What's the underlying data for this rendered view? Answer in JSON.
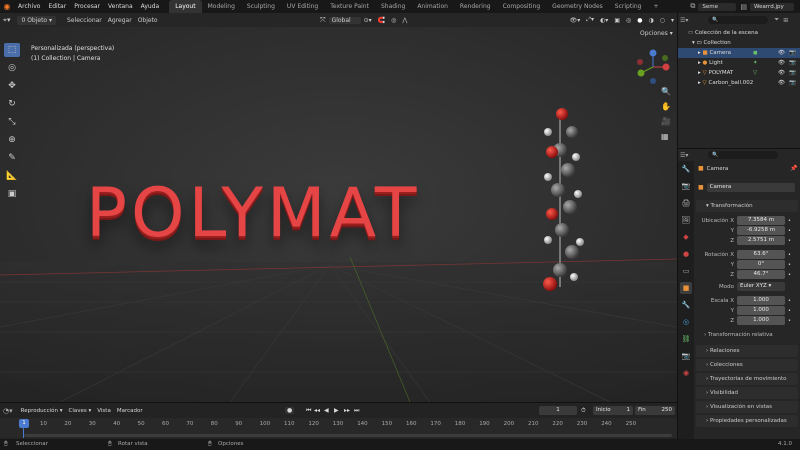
{
  "topbar": {
    "menus": [
      "Archivo",
      "Editar",
      "Procesar",
      "Ventana",
      "Ayuda"
    ],
    "workspaces": [
      "Layout",
      "Modeling",
      "Sculpting",
      "UV Editing",
      "Texture Paint",
      "Shading",
      "Animation",
      "Rendering",
      "Compositing",
      "Geometry Nodes",
      "Scripting"
    ],
    "active_workspace": "Layout",
    "scene": "Seme",
    "view_layer": "Wearrd.jpy"
  },
  "viewport_header": {
    "object_mode": "0 Objeto",
    "menus": [
      "Seleccionar",
      "Agregar",
      "Objeto"
    ],
    "transform_orientation": "Global",
    "options": "Opciones"
  },
  "viewport": {
    "view_name": "Personalizada (perspectiva)",
    "collection_info": "(1) Collection | Camera",
    "scene_text": "POLYMAT",
    "gizmo_axes": {
      "x": "X",
      "y": "Y",
      "z": "Z"
    }
  },
  "outliner": {
    "root": "Colección de la escena",
    "items": [
      {
        "name": "Collection",
        "color": "#cccccc"
      },
      {
        "name": "Camera",
        "color": "#ffffff"
      },
      {
        "name": "Light",
        "color": "#dddddd"
      },
      {
        "name": "POLYMAT",
        "color": "#dddddd"
      },
      {
        "name": "Carbon_ball.002",
        "color": "#dddddd"
      }
    ]
  },
  "properties": {
    "object_name": "Camera",
    "object_field": "Camera",
    "transform_title": "Transformación",
    "location_label": "Ubicación X",
    "location": [
      "7.3584 m",
      "-6.9258 m",
      "2.5751 m"
    ],
    "rotation_label": "Rotación X",
    "rotation": [
      "63.6°",
      "0°",
      "46.7°"
    ],
    "mode_label": "Modo",
    "mode_value": "Euler XYZ",
    "scale_label": "Escala X",
    "scale": [
      "1.000",
      "1.000",
      "1.000"
    ],
    "axis_y": "Y",
    "axis_z": "Z",
    "delta_title": "Transformación relativa",
    "panels": [
      "Relaciones",
      "Colecciones",
      "Trayectorias de movimiento",
      "Visibilidad",
      "Visualización en vistas",
      "Propiedades personalizadas"
    ]
  },
  "timeline": {
    "menus": [
      "Reproducción",
      "Claves",
      "Vista",
      "Marcador"
    ],
    "current_frame": "1",
    "start_label": "Inicio",
    "start": "1",
    "end_label": "Fin",
    "end": "250",
    "ticks": [
      "10",
      "20",
      "30",
      "40",
      "50",
      "60",
      "70",
      "80",
      "90",
      "100",
      "110",
      "120",
      "130",
      "140",
      "150",
      "160",
      "170",
      "180",
      "190",
      "200",
      "210",
      "220",
      "230",
      "240",
      "250"
    ],
    "playhead": "1"
  },
  "statusbar": {
    "left": "Seleccionar",
    "middle": "Rotar vista",
    "right": "Opciones",
    "version": "4.1.0"
  },
  "colors": {
    "accent": "#4a6ea9",
    "text_red": "#d63a3a",
    "workspace_active": "#333333"
  }
}
